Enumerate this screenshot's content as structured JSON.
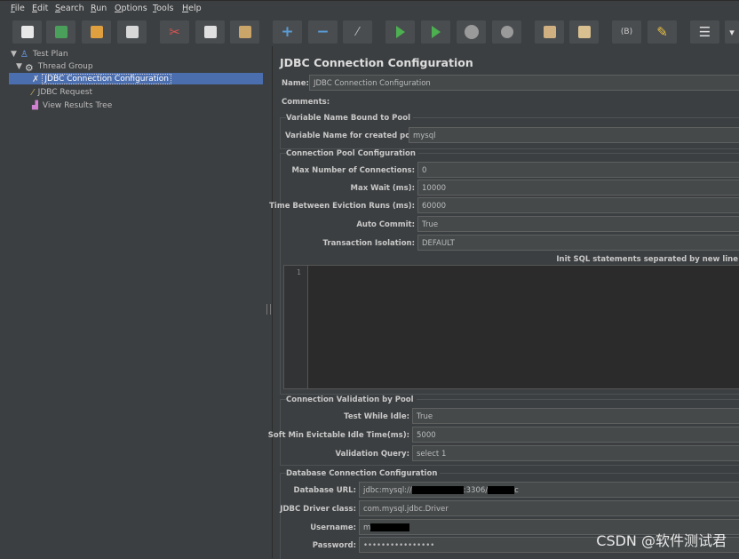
{
  "menu": [
    "File",
    "Edit",
    "Search",
    "Run",
    "Options",
    "Tools",
    "Help"
  ],
  "toolbar": {
    "icons": [
      "new-icon",
      "templates-icon",
      "open-icon",
      "save-icon",
      "cut-icon",
      "copy-icon",
      "paste-icon",
      "expand-icon",
      "collapse-icon",
      "toggle-icon",
      "start-icon",
      "start-no-pauses-icon",
      "stop-icon",
      "shutdown-icon",
      "clear-icon",
      "clear-all-icon",
      "search-icon",
      "reset-search-icon",
      "function-helper-icon",
      "help-icon"
    ],
    "colors": {
      "add": "#5b9bd5",
      "run": "#4caf50",
      "stop": "#9a9a9a",
      "cut": "#d9534f"
    }
  },
  "tree": {
    "items": [
      {
        "label": "Test Plan"
      },
      {
        "label": "Thread Group"
      },
      {
        "label": "JDBC Connection Configuration"
      },
      {
        "label": "JDBC Request"
      },
      {
        "label": "View Results Tree"
      }
    ]
  },
  "panel": {
    "title": "JDBC Connection Configuration",
    "name_label": "Name:",
    "name_value": "JDBC Connection Configuration",
    "comments_label": "Comments:",
    "var_section": "Variable Name Bound to Pool",
    "var_label": "Variable Name for created pool:",
    "var_value": "mysql",
    "pool_section": "Connection Pool Configuration",
    "max_conn_label": "Max Number of Connections:",
    "max_conn_value": "0",
    "max_wait_label": "Max Wait (ms):",
    "max_wait_value": "10000",
    "eviction_label": "Time Between Eviction Runs (ms):",
    "eviction_value": "60000",
    "autocommit_label": "Auto Commit:",
    "autocommit_value": "True",
    "isolation_label": "Transaction Isolation:",
    "isolation_value": "DEFAULT",
    "init_sql_label": "Init SQL statements separated by new line",
    "editor_line": "1",
    "validation_section": "Connection Validation by Pool",
    "test_idle_label": "Test While Idle:",
    "test_idle_value": "True",
    "soft_min_label": "Soft Min Evictable Idle Time(ms):",
    "soft_min_value": "5000",
    "validation_query_label": "Validation Query:",
    "validation_query_value": "select 1",
    "db_section": "Database Connection Configuration",
    "url_label": "Database URL:",
    "url_prefix": "jdbc:mysql://",
    "url_port": ":3306/",
    "url_suffix": "c",
    "driver_label": "JDBC Driver class:",
    "driver_value": "com.mysql.jdbc.Driver",
    "username_label": "Username:",
    "username_value": "m",
    "password_label": "Password:",
    "password_value": "••••••••••••••••"
  },
  "watermark": "CSDN @软件测试君"
}
